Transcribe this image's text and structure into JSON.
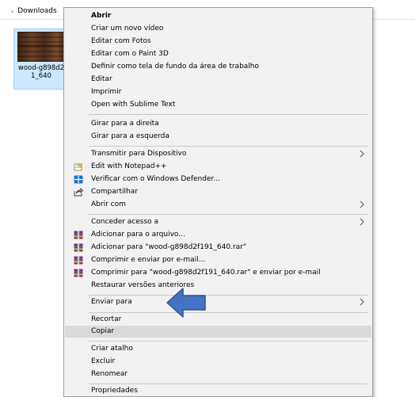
{
  "explorer": {
    "breadcrumb_label": "Downloads",
    "file_name": "wood-g898d2\n1_640"
  },
  "menu": {
    "items": [
      {
        "label": "Abrir"
      },
      {
        "label": "Criar um novo vídeo"
      },
      {
        "label": "Editar com Fotos"
      },
      {
        "label": "Editar com o Paint 3D"
      },
      {
        "label": "Definir como tela de fundo da área de trabalho"
      },
      {
        "label": "Editar"
      },
      {
        "label": "Imprimir"
      },
      {
        "label": "Open with Sublime Text"
      },
      {
        "label": "Girar para a direita"
      },
      {
        "label": "Girar para a esquerda"
      },
      {
        "label": "Transmitir para Dispositivo"
      },
      {
        "label": "Edit with Notepad++"
      },
      {
        "label": "Verificar com o Windows Defender..."
      },
      {
        "label": "Compartilhar"
      },
      {
        "label": "Abrir com"
      },
      {
        "label": "Conceder acesso a"
      },
      {
        "label": "Adicionar para o arquivo..."
      },
      {
        "label": "Adicionar para \"wood-g898d2f191_640.rar\""
      },
      {
        "label": "Comprimir e enviar por e-mail..."
      },
      {
        "label": "Comprimir para \"wood-g898d2f191_640.rar\" e enviar por e-mail"
      },
      {
        "label": "Restaurar versões anteriores"
      },
      {
        "label": "Enviar para"
      },
      {
        "label": "Recortar"
      },
      {
        "label": "Copiar"
      },
      {
        "label": "Criar atalho"
      },
      {
        "label": "Excluir"
      },
      {
        "label": "Renomear"
      },
      {
        "label": "Propriedades"
      }
    ]
  },
  "colors": {
    "menu_bg": "#f2f2f2",
    "hover_bg": "#dadada",
    "selection_bg": "#cce8ff",
    "annotation_arrow": "#4472c4"
  },
  "icons": {
    "notepad": "notepad-plus-plus-icon",
    "defender": "windows-defender-icon",
    "share": "share-icon",
    "winrar": "winrar-icon",
    "submenu": "chevron-right-icon"
  }
}
